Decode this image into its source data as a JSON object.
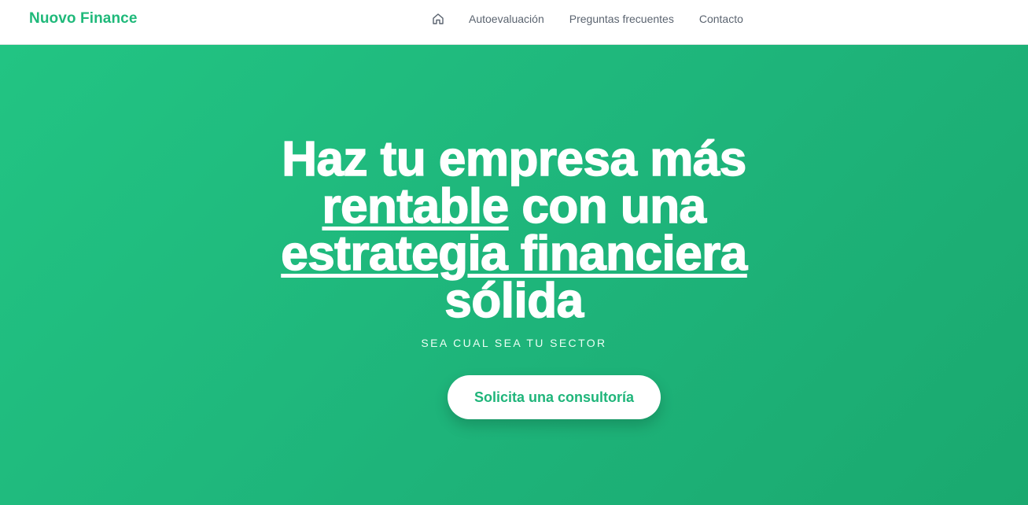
{
  "brand": {
    "logo_text": "Nuovo Finance",
    "color": "#1fb97a"
  },
  "nav": {
    "home_icon": "home-icon",
    "links": [
      "Autoevaluación",
      "Preguntas frecuentes",
      "Contacto"
    ]
  },
  "hero": {
    "title_line1": "Haz tu empresa más",
    "title_line2_underlined": "rentable",
    "title_line2_rest": " con una",
    "title_line3_underlined_a": "estrate",
    "title_line3_plain": "g",
    "title_line3_underlined_b": "ia financiera",
    "title_line4": "sólida",
    "subtitle": "SEA CUAL SEA TU SECTOR",
    "cta_label": "Solicita una consultoría",
    "background_color": "#20b87c"
  }
}
